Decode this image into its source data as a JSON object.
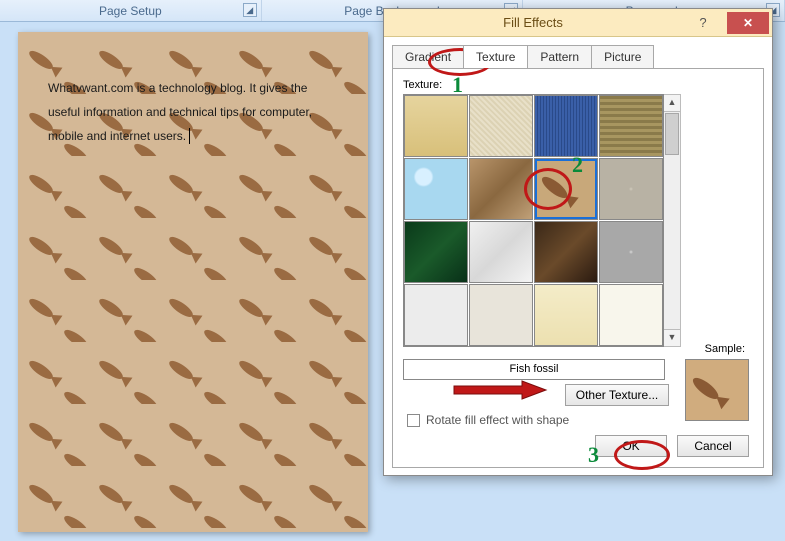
{
  "ribbon": {
    "groups": [
      "Page Setup",
      "Page Background",
      "Paragraph"
    ]
  },
  "document": {
    "text": "Whatvwant.com is a technology blog. It gives the useful information and technical tips for computer, mobile and internet users."
  },
  "dialog": {
    "title": "Fill Effects",
    "tabs": [
      "Gradient",
      "Texture",
      "Pattern",
      "Picture"
    ],
    "active_tab": 1,
    "texture_label": "Texture:",
    "selected_texture_name": "Fish fossil",
    "other_texture_btn": "Other Texture...",
    "sample_label": "Sample:",
    "rotate_label": "Rotate fill effect with shape",
    "ok": "OK",
    "cancel": "Cancel",
    "textures": [
      {
        "name": "papyrus",
        "bg": "linear-gradient(#e6d49e,#d8c07a)"
      },
      {
        "name": "canvas",
        "bg": "repeating-linear-gradient(45deg,#e8e0c8 0 2px,#dcd2b4 2px 4px)"
      },
      {
        "name": "denim",
        "bg": "repeating-linear-gradient(90deg,#3a5fa8 0 2px,#2a4a8a 2px 3px)"
      },
      {
        "name": "woven-mat",
        "bg": "repeating-linear-gradient(0deg,#a89660 0 3px,#8a7a4a 3px 6px)"
      },
      {
        "name": "water-droplets",
        "bg": "radial-gradient(circle at 30% 30%,#d8f0ff 8px,#a8d8f0 10px)"
      },
      {
        "name": "paper-bag",
        "bg": "linear-gradient(135deg,#b8946a,#8a6840,#c0a078)"
      },
      {
        "name": "fish-fossil",
        "bg": "#c8a87a"
      },
      {
        "name": "sand",
        "bg": "radial-gradient(#c8c2b4 1px,#b8b2a4 2px)"
      },
      {
        "name": "green-marble",
        "bg": "linear-gradient(135deg,#0a3a1a,#1a5a2a,#083018)"
      },
      {
        "name": "white-marble",
        "bg": "linear-gradient(135deg,#f0f0f0,#d8d8d8,#f4f4f4)"
      },
      {
        "name": "brown-marble",
        "bg": "linear-gradient(135deg,#3a2818,#6a4a2a,#2a1a10)"
      },
      {
        "name": "granite",
        "bg": "radial-gradient(#c8c8c8 1px,#a8a8a8 2px)"
      },
      {
        "name": "newsprint",
        "bg": "#ececec"
      },
      {
        "name": "recycled-paper",
        "bg": "#e8e4da"
      },
      {
        "name": "parchment",
        "bg": "linear-gradient(#f4ecc8,#ece0b0)"
      },
      {
        "name": "stationery",
        "bg": "#f8f6ec"
      }
    ]
  },
  "annotations": {
    "n1": "1",
    "n2": "2",
    "n3": "3"
  }
}
